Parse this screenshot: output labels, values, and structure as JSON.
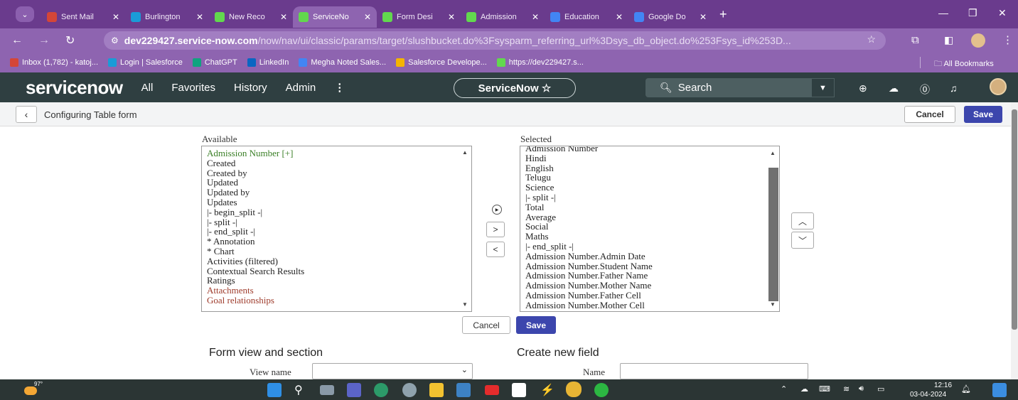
{
  "browser": {
    "tabs": [
      {
        "label": "Sent Mail",
        "icon": "gmail-icon",
        "color": "#d44638"
      },
      {
        "label": "Burlington",
        "icon": "salesforce-icon",
        "color": "#1a9bd7"
      },
      {
        "label": "New Reco",
        "icon": "servicenow-icon",
        "color": "#62d84e"
      },
      {
        "label": "ServiceNo",
        "icon": "servicenow-icon",
        "color": "#62d84e",
        "active": true
      },
      {
        "label": "Form Desi",
        "icon": "servicenow-icon",
        "color": "#62d84e"
      },
      {
        "label": "Admission",
        "icon": "servicenow-icon",
        "color": "#62d84e"
      },
      {
        "label": "Education",
        "icon": "docs-icon",
        "color": "#4285f4"
      },
      {
        "label": "Google Do",
        "icon": "docs-icon",
        "color": "#4285f4"
      }
    ],
    "url_host": "dev229427.service-now.com",
    "url_path": "/now/nav/ui/classic/params/target/slushbucket.do%3Fsysparm_referring_url%3Dsys_db_object.do%253Fsys_id%253D...",
    "bookmarks": [
      {
        "label": "Inbox (1,782) - katoj...",
        "color": "#d44638"
      },
      {
        "label": "Login | Salesforce",
        "color": "#1a9bd7"
      },
      {
        "label": "ChatGPT",
        "color": "#10a37f"
      },
      {
        "label": "LinkedIn",
        "color": "#0a66c2"
      },
      {
        "label": "Megha Noted Sales...",
        "color": "#4285f4"
      },
      {
        "label": "Salesforce Develope...",
        "color": "#f4b400"
      },
      {
        "label": "https://dev229427.s...",
        "color": "#62d84e"
      }
    ],
    "all_bookmarks": "All Bookmarks"
  },
  "servicenow": {
    "logo": "servicenow",
    "nav": [
      "All",
      "Favorites",
      "History",
      "Admin"
    ],
    "pill": "ServiceNow ☆",
    "search_placeholder": "Search"
  },
  "header": {
    "title": "Configuring Table form",
    "cancel": "Cancel",
    "save": "Save"
  },
  "slushbucket": {
    "available_label": "Available",
    "selected_label": "Selected",
    "available": [
      {
        "text": "Admission Number [+]",
        "color": "green"
      },
      {
        "text": "Created"
      },
      {
        "text": "Created by"
      },
      {
        "text": "Updated"
      },
      {
        "text": "Updated by"
      },
      {
        "text": "Updates"
      },
      {
        "text": "|- begin_split -|"
      },
      {
        "text": "|- split -|"
      },
      {
        "text": "|- end_split -|"
      },
      {
        "text": "* Annotation"
      },
      {
        "text": "* Chart"
      },
      {
        "text": "Activities (filtered)"
      },
      {
        "text": "Contextual Search Results"
      },
      {
        "text": "Ratings"
      },
      {
        "text": "Attachments",
        "color": "red"
      },
      {
        "text": "Goal relationships",
        "color": "red"
      }
    ],
    "selected": [
      "Admission Number",
      "Hindi",
      "English",
      "Telugu",
      "Science",
      "|- split -|",
      "Total",
      "Average",
      "Social",
      "Maths",
      "|- end_split -|",
      "Admission Number.Admin Date",
      "Admission Number.Student Name",
      "Admission Number.Father Name",
      "Admission Number.Mother Name",
      "Admission Number.Father Cell",
      "Admission Number.Mother Cell"
    ],
    "cancel": "Cancel",
    "save": "Save"
  },
  "form_view": {
    "title": "Form view and section",
    "view_name_label": "View name",
    "view_name_value": ""
  },
  "new_field": {
    "title": "Create new field",
    "name_label": "Name",
    "name_value": ""
  },
  "taskbar": {
    "weather": "97°",
    "time": "12:16",
    "date": "03-04-2024"
  }
}
